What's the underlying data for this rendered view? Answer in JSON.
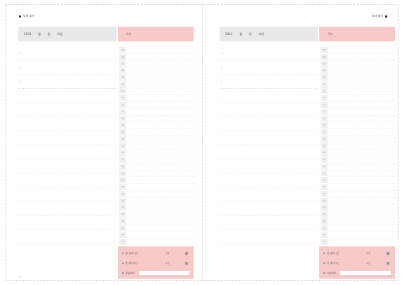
{
  "left_page": {
    "header": "부자 되기",
    "date": {
      "year_label": "2023",
      "month_label": "월",
      "day_label": "일",
      "weekday_label": "요일"
    },
    "goal_label": "목표",
    "hours": [
      "05",
      "06",
      "07",
      "08",
      "09",
      "10",
      "11",
      "12",
      "13",
      "14",
      "15",
      "16",
      "17",
      "18",
      "19",
      "20",
      "21",
      "22",
      "23",
      "24",
      "01",
      "02",
      "03",
      "04",
      "05",
      "06",
      "07",
      "08",
      "09",
      "10",
      "11",
      "12"
    ],
    "summary": {
      "rows": [
        {
          "label": "총 공부시간",
          "value": "시간"
        },
        {
          "label": "총 휴식시간",
          "value": "시간"
        },
        {
          "label": "오늘메모",
          "value": ""
        }
      ]
    },
    "page_number": "01"
  },
  "right_page": {
    "header": "부자 되기",
    "date": {
      "year_label": "2023",
      "month_label": "월",
      "day_label": "일",
      "weekday_label": "요일"
    },
    "goal_label": "목표",
    "hours": [
      "05",
      "06",
      "07",
      "08",
      "09",
      "10",
      "11",
      "12",
      "13",
      "14",
      "15",
      "16",
      "17",
      "18",
      "19",
      "20",
      "21",
      "22",
      "23",
      "24",
      "01",
      "02",
      "03",
      "04",
      "05",
      "06",
      "07",
      "08",
      "09",
      "10",
      "11",
      "12"
    ],
    "summary": {
      "rows": [
        {
          "label": "총 공부시간",
          "value": "시간"
        },
        {
          "label": "총 휴식시간",
          "value": "시간"
        },
        {
          "label": "오늘메모",
          "value": ""
        }
      ]
    },
    "page_number": "02"
  },
  "colors": {
    "accent_pink": "#f8c9c9",
    "date_bar_gray": "#e9e9e9",
    "hours_gray": "#f0f0f0"
  }
}
